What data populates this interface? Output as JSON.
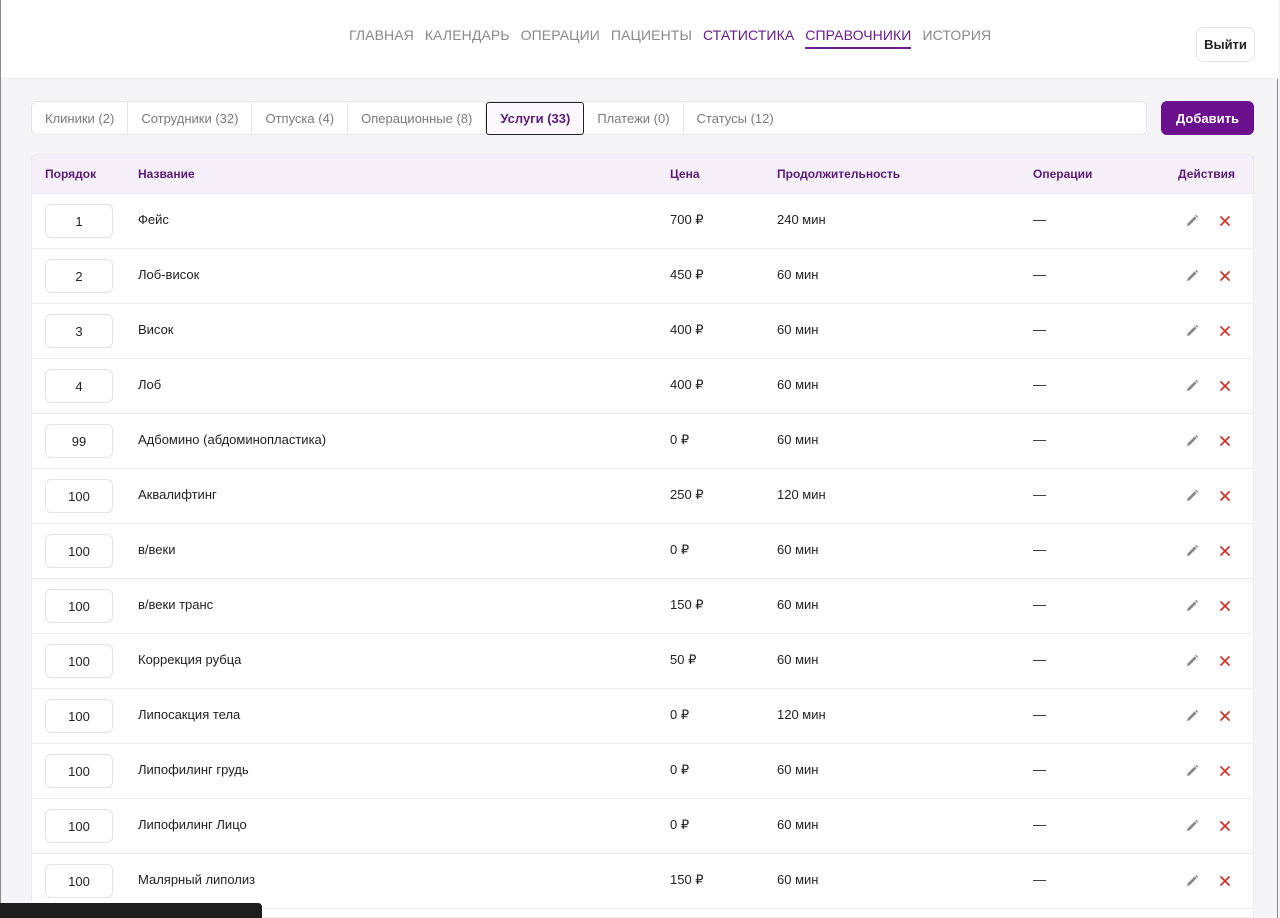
{
  "nav": {
    "items": [
      {
        "label": "ГЛАВНАЯ",
        "style": "gray"
      },
      {
        "label": "КАЛЕНДАРЬ",
        "style": "gray"
      },
      {
        "label": "ОПЕРАЦИИ",
        "style": "gray"
      },
      {
        "label": "ПАЦИЕНТЫ",
        "style": "gray"
      },
      {
        "label": "СТАТИСТИКА",
        "style": "purple"
      },
      {
        "label": "СПРАВОЧНИКИ",
        "style": "active"
      },
      {
        "label": "ИСТОРИЯ",
        "style": "gray"
      }
    ],
    "logout_label": "Выйти"
  },
  "tabs": [
    {
      "label": "Клиники (2)",
      "active": false
    },
    {
      "label": "Сотрудники (32)",
      "active": false
    },
    {
      "label": "Отпуска (4)",
      "active": false
    },
    {
      "label": "Операционные (8)",
      "active": false
    },
    {
      "label": "Услуги (33)",
      "active": true
    },
    {
      "label": "Платежи (0)",
      "active": false
    },
    {
      "label": "Статусы (12)",
      "active": false
    }
  ],
  "add_button_label": "Добавить",
  "table": {
    "headers": {
      "order": "Порядок",
      "name": "Название",
      "price": "Цена",
      "duration": "Продолжительность",
      "operations": "Операции",
      "actions": "Действия"
    },
    "rows": [
      {
        "order": "1",
        "name": "Фейс",
        "price": "700 ₽",
        "duration": "240 мин",
        "operations": "—"
      },
      {
        "order": "2",
        "name": "Лоб-висок",
        "price": "450 ₽",
        "duration": "60 мин",
        "operations": "—"
      },
      {
        "order": "3",
        "name": "Висок",
        "price": "400 ₽",
        "duration": "60 мин",
        "operations": "—"
      },
      {
        "order": "4",
        "name": "Лоб",
        "price": "400 ₽",
        "duration": "60 мин",
        "operations": "—"
      },
      {
        "order": "99",
        "name": "Адбомино (абдоминопластика)",
        "price": "0 ₽",
        "duration": "60 мин",
        "operations": "—"
      },
      {
        "order": "100",
        "name": "Аквалифтинг",
        "price": "250 ₽",
        "duration": "120 мин",
        "operations": "—"
      },
      {
        "order": "100",
        "name": "в/веки",
        "price": "0 ₽",
        "duration": "60 мин",
        "operations": "—"
      },
      {
        "order": "100",
        "name": "в/веки транс",
        "price": "150 ₽",
        "duration": "60 мин",
        "operations": "—"
      },
      {
        "order": "100",
        "name": "Коррекция рубца",
        "price": "50 ₽",
        "duration": "60 мин",
        "operations": "—"
      },
      {
        "order": "100",
        "name": "Липосакция тела",
        "price": "0 ₽",
        "duration": "120 мин",
        "operations": "—"
      },
      {
        "order": "100",
        "name": "Липофилинг грудь",
        "price": "0 ₽",
        "duration": "60 мин",
        "operations": "—"
      },
      {
        "order": "100",
        "name": "Липофилинг Лицо",
        "price": "0 ₽",
        "duration": "60 мин",
        "operations": "—"
      },
      {
        "order": "100",
        "name": "Малярный липолиз",
        "price": "150 ₽",
        "duration": "60 мин",
        "operations": "—"
      }
    ]
  },
  "status_tooltip": "",
  "colors": {
    "accent": "#6a0f8e",
    "delete": "#d0342c",
    "edit": "#8a8a8a"
  }
}
